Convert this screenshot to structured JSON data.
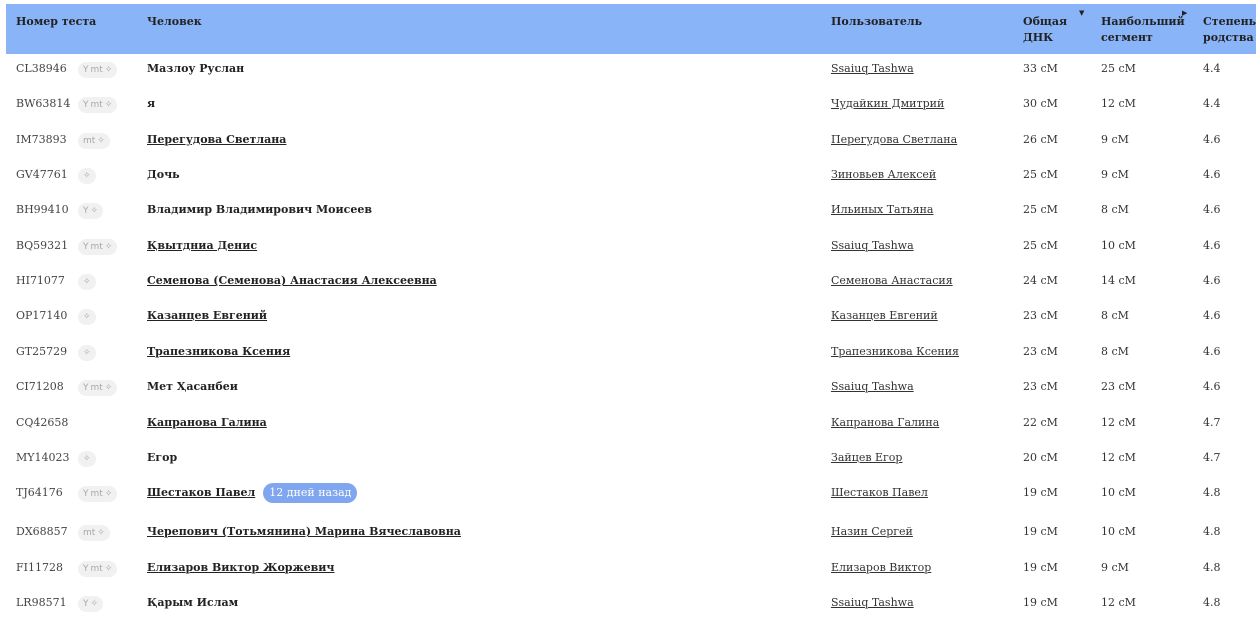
{
  "columns": {
    "test": "Номер теста",
    "person": "Человек",
    "user": "Пользователь",
    "total": "Общая ДНК",
    "segment": "Наибольший сегмент",
    "degree": "Степень родства"
  },
  "rows": [
    {
      "test": "CL38946",
      "icons": [
        "Y",
        "mt",
        "✧"
      ],
      "person": "Мазлоу Руслан",
      "person_linked": false,
      "user": "Ssaiuq Tashwa",
      "total": "33 сМ",
      "segment": "25 сМ",
      "degree": "4.4"
    },
    {
      "test": "BW63814",
      "icons": [
        "Y",
        "mt",
        "✧"
      ],
      "person": "я",
      "person_linked": false,
      "user": "Чудайкин Дмитрий",
      "total": "30 сМ",
      "segment": "12 сМ",
      "degree": "4.4"
    },
    {
      "test": "IM73893",
      "icons": [
        "mt",
        "✧"
      ],
      "person": "Перегудова Светлана",
      "person_linked": true,
      "user": "Перегудова Светлана",
      "total": "26 сМ",
      "segment": "9 сМ",
      "degree": "4.6"
    },
    {
      "test": "GV47761",
      "icons": [
        "✧"
      ],
      "person": "Дочь",
      "person_linked": false,
      "user": "Зиновьев Алексей",
      "total": "25 сМ",
      "segment": "9 сМ",
      "degree": "4.6"
    },
    {
      "test": "BH99410",
      "icons": [
        "Y",
        "✧"
      ],
      "person": "Владимир Владимирович Моисеев",
      "person_linked": false,
      "user": "Ильиных Татьяна",
      "total": "25 сМ",
      "segment": "8 сМ",
      "degree": "4.6"
    },
    {
      "test": "BQ59321",
      "icons": [
        "Y",
        "mt",
        "✧"
      ],
      "person": "Қвытдниа Денис",
      "person_linked": true,
      "user": "Ssaiuq Tashwa",
      "total": "25 сМ",
      "segment": "10 сМ",
      "degree": "4.6"
    },
    {
      "test": "HI71077",
      "icons": [
        "✧"
      ],
      "person": "Семенова (Семенова) Анастасия Алексеевна",
      "person_linked": true,
      "user": "Семенова Анастасия",
      "total": "24 сМ",
      "segment": "14 сМ",
      "degree": "4.6"
    },
    {
      "test": "OP17140",
      "icons": [
        "✧"
      ],
      "person": "Казанцев Евгений",
      "person_linked": true,
      "user": "Казанцев Евгений",
      "total": "23 сМ",
      "segment": "8 сМ",
      "degree": "4.6"
    },
    {
      "test": "GT25729",
      "icons": [
        "✧"
      ],
      "person": "Трапезникова Ксения",
      "person_linked": true,
      "user": "Трапезникова Ксения",
      "total": "23 сМ",
      "segment": "8 сМ",
      "degree": "4.6"
    },
    {
      "test": "CI71208",
      "icons": [
        "Y",
        "mt",
        "✧"
      ],
      "person": "Мет Ҳасанбеи",
      "person_linked": false,
      "user": "Ssaiuq Tashwa",
      "total": "23 сМ",
      "segment": "23 сМ",
      "degree": "4.6"
    },
    {
      "test": "CQ42658",
      "icons": [],
      "person": "Капранова Галина",
      "person_linked": true,
      "user": "Капранова Галина",
      "total": "22 сМ",
      "segment": "12 сМ",
      "degree": "4.7"
    },
    {
      "test": "MY14023",
      "icons": [
        "✧"
      ],
      "person": "Егор",
      "person_linked": false,
      "user": "Зайцев Егор",
      "total": "20 сМ",
      "segment": "12 сМ",
      "degree": "4.7"
    },
    {
      "test": "TJ64176",
      "icons": [
        "Y",
        "mt",
        "✧"
      ],
      "person": "Шестаков Павел",
      "person_linked": true,
      "badge": "12 дней назад",
      "user": "Шестаков Павел",
      "total": "19 сМ",
      "segment": "10 сМ",
      "degree": "4.8"
    },
    {
      "test": "DX68857",
      "icons": [
        "mt",
        "✧"
      ],
      "person": "Черепович (Тотьмянина) Марина Вячеславовна",
      "person_linked": true,
      "user": "Назин Сергей",
      "total": "19 сМ",
      "segment": "10 сМ",
      "degree": "4.8"
    },
    {
      "test": "FI11728",
      "icons": [
        "Y",
        "mt",
        "✧"
      ],
      "person": "Елизаров Виктор Жоржевич",
      "person_linked": true,
      "user": "Елизаров Виктор",
      "total": "19 сМ",
      "segment": "9 сМ",
      "degree": "4.8"
    },
    {
      "test": "LR98571",
      "icons": [
        "Y",
        "✧"
      ],
      "person": "Қарым Ислам",
      "person_linked": false,
      "user": "Ssaiuq Tashwa",
      "total": "19 сМ",
      "segment": "12 сМ",
      "degree": "4.8"
    }
  ]
}
